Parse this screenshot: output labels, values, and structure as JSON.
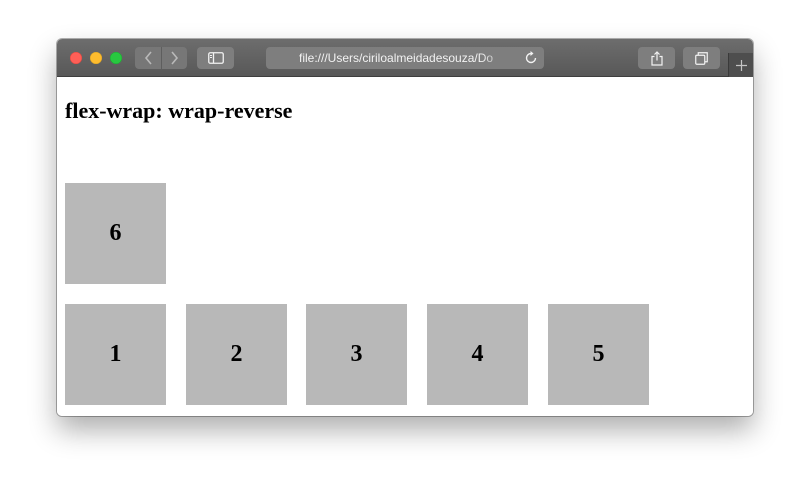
{
  "browser": {
    "url": "file:///Users/ciriloalmeidadesouza/Do",
    "colors": {
      "close": "#fe5f57",
      "minimize": "#febc2e",
      "zoom": "#28c840",
      "toolbar": "#5f5f5f"
    },
    "icons": [
      "back-icon",
      "forward-icon",
      "sidebar-icon",
      "reload-icon",
      "share-icon",
      "tabs-overview-icon",
      "plus-icon"
    ]
  },
  "page": {
    "heading": "flex-wrap: wrap-reverse",
    "box_color": "#b8b8b8",
    "items": [
      "1",
      "2",
      "3",
      "4",
      "5",
      "6"
    ]
  }
}
